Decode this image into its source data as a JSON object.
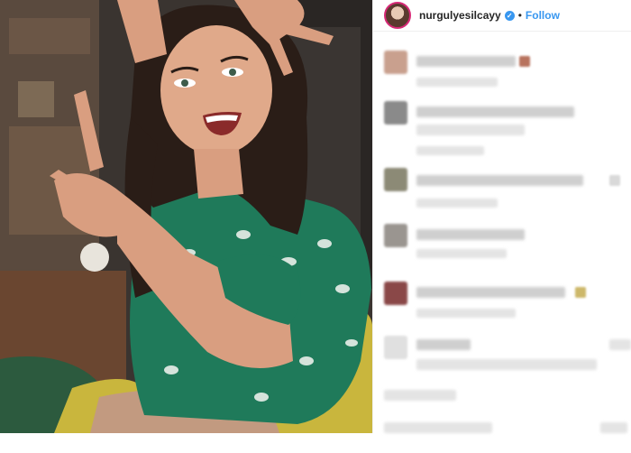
{
  "header": {
    "username": "nurgulyesilcayy",
    "verified_icon": "verified-badge-icon",
    "separator": "•",
    "follow_label": "Follow"
  },
  "colors": {
    "follow_blue": "#3897f0",
    "dress_green": "#1f7a5a",
    "chair_yellow": "#c8b43a",
    "border": "#efefef"
  },
  "comments_state": "blurred / pixelated (unreadable)"
}
